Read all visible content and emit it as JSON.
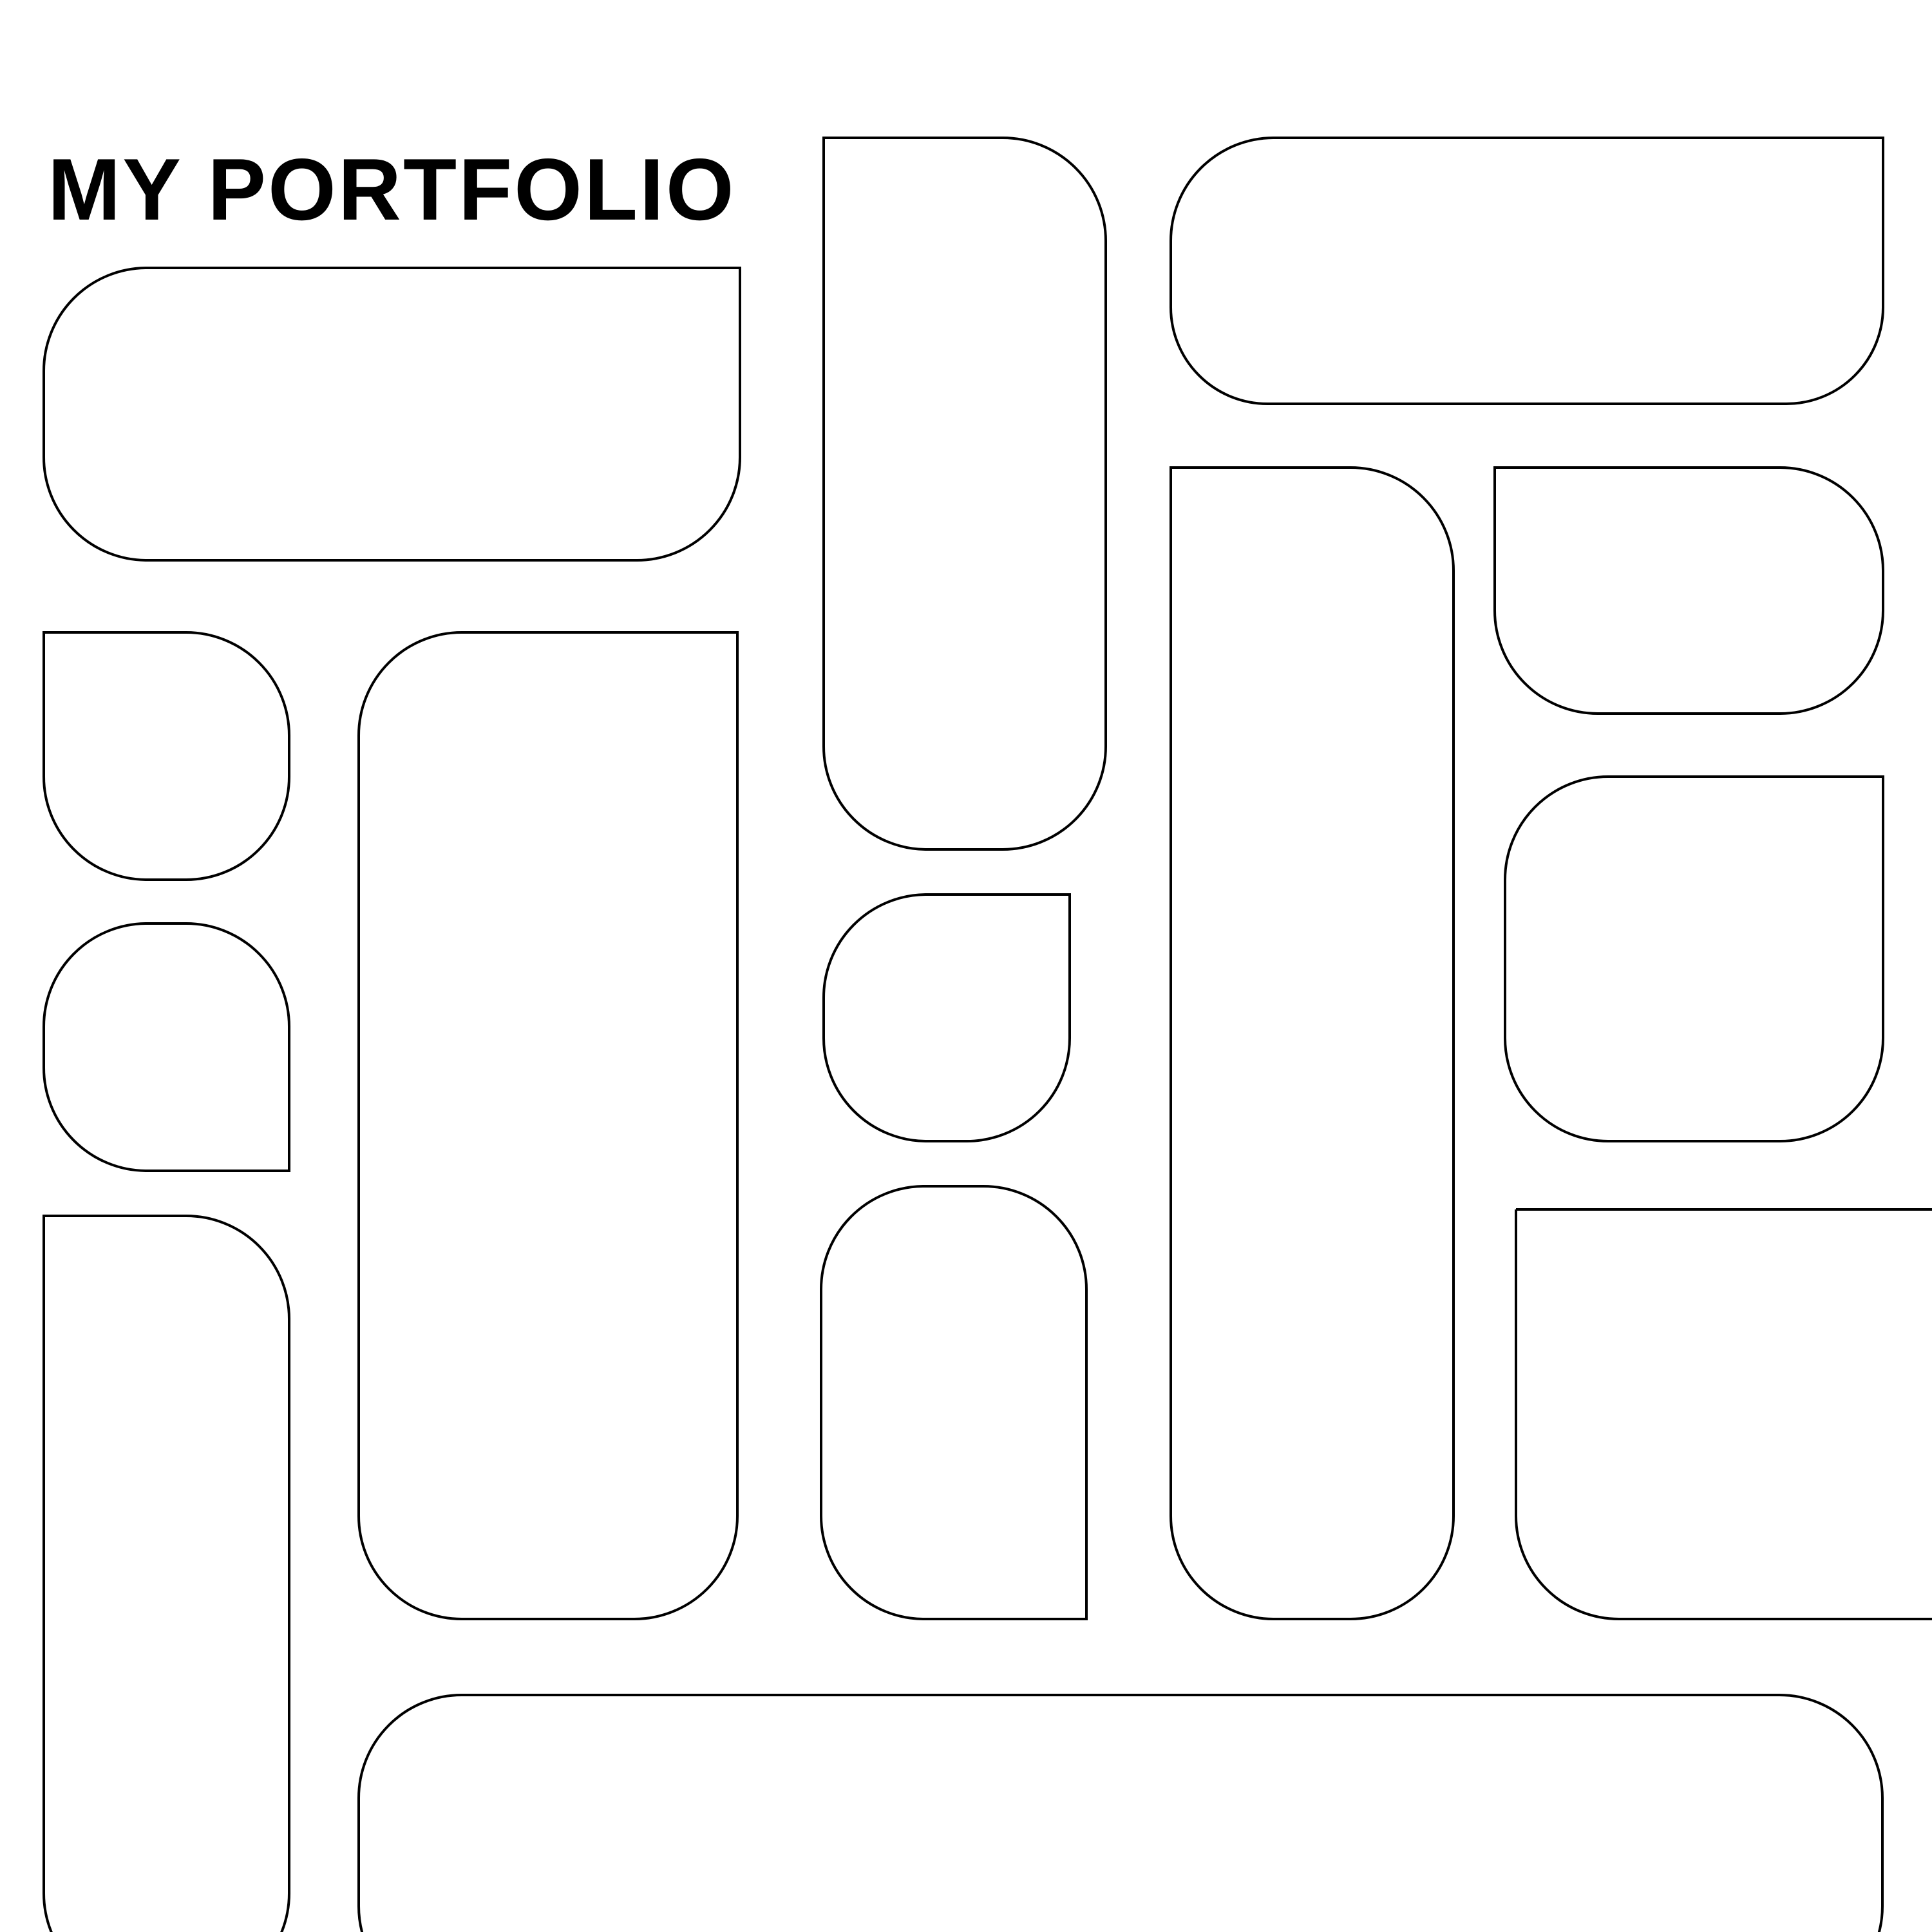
{
  "page": {
    "title": "MY PORTFOLIO"
  },
  "colors": {
    "background": "#ffffff",
    "ink": "#000000"
  }
}
